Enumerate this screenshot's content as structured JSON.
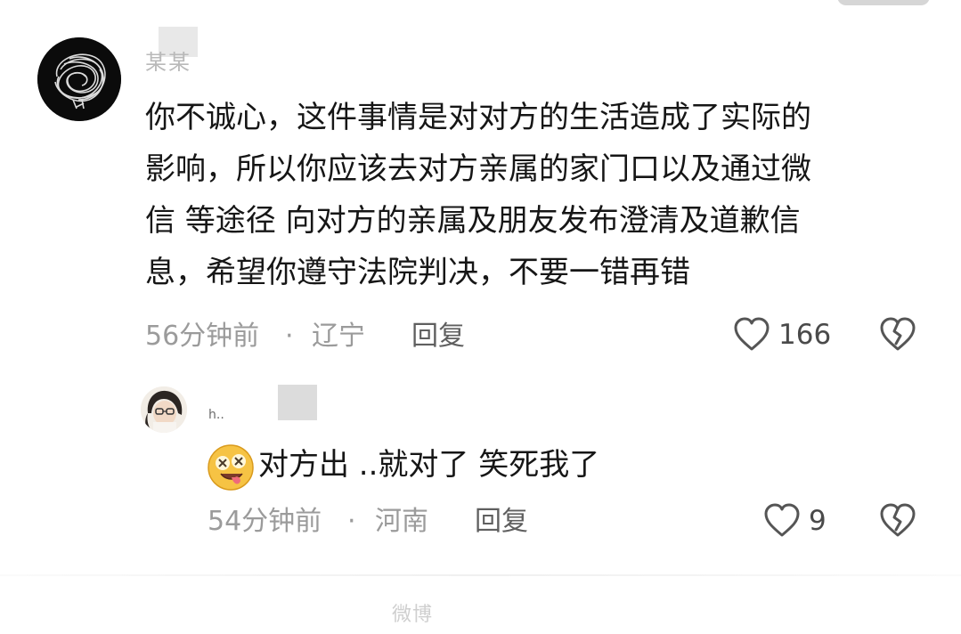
{
  "comment": {
    "username": "某某",
    "text": "你不诚心，这件事情是对对方的生活造成了实际的\n影响，所以你应该去对方亲属的家门口以及通过微\n信 等途径 向对方的亲属及朋友发布澄清及道歉信\n息，希望你遵守法院判决，不要一错再错",
    "time": "56分钟前",
    "separator": "·",
    "location": "辽宁",
    "reply_label": "回复",
    "like_count": "166"
  },
  "reply": {
    "username": "h..",
    "text": "对方出 ..就对了 笑死我了",
    "time": "54分钟前",
    "separator": "·",
    "location": "河南",
    "reply_label": "回复",
    "like_count": "9"
  },
  "watermark": "微博",
  "colors": {
    "text": "#161616",
    "meta": "#9b9b9b",
    "reply": "#5f5f5f",
    "icon": "#555555",
    "background": "#ffffff"
  },
  "icons": [
    "scribble-avatar",
    "heart-outline-icon",
    "dislike-broken-heart-icon",
    "drooling-emoji"
  ]
}
